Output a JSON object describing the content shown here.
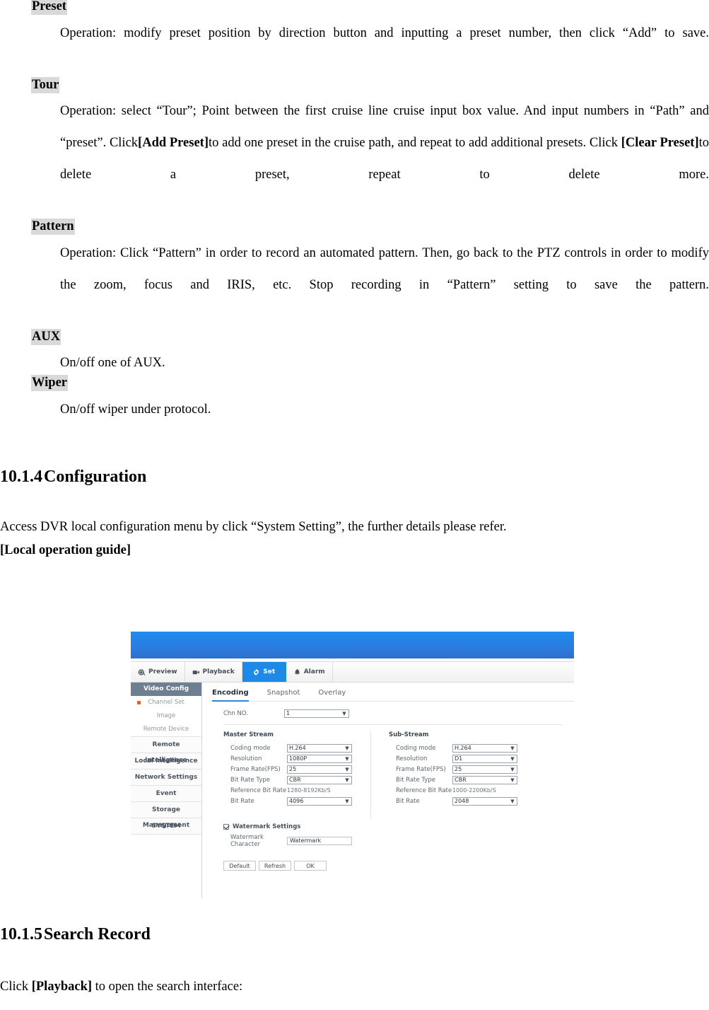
{
  "document": {
    "terms": [
      {
        "heading": "Preset",
        "body": "Operation: modify preset position by direction button and inputting a preset number, then click “Add” to save."
      },
      {
        "heading": "Tour",
        "body_part1": "Operation: select “Tour”; Point between the first cruise line cruise input box value. And input numbers in “Path” and “preset”. Click",
        "bold1": "[Add Preset]",
        "body_part2": "to add one preset in the cruise path, and repeat to add additional presets. Click ",
        "bold2": "[Clear Preset]",
        "body_part3": "to delete a preset, repeat to delete more."
      },
      {
        "heading": "Pattern",
        "body": "Operation: Click “Pattern” in order to record an automated pattern. Then, go back to the PTZ controls in order to modify the zoom, focus and IRIS, etc. Stop recording in “Pattern” setting to save the pattern."
      },
      {
        "heading": "AUX",
        "body": "On/off one of AUX."
      },
      {
        "heading": "Wiper",
        "body": "On/off wiper under protocol."
      }
    ],
    "section_config": {
      "number": "10.1.4",
      "title": "Configuration",
      "para": "Access DVR local configuration menu by click “System Setting”, the further details please refer.",
      "bold_line": "[Local operation guide]"
    },
    "section_search": {
      "number": "10.1.5",
      "title": "Search Record",
      "para_prefix": "Click ",
      "para_bold": "[Playback]",
      "para_suffix": " to open the search interface:"
    }
  },
  "screenshot": {
    "header_color": "#1f8cf0",
    "nav_tabs": [
      {
        "label": "Preview",
        "icon": "preview-icon",
        "active": false
      },
      {
        "label": "Playback",
        "icon": "playback-icon",
        "active": false
      },
      {
        "label": "Set",
        "icon": "gear-icon",
        "active": true
      },
      {
        "label": "Alarm",
        "icon": "bell-icon",
        "active": false
      }
    ],
    "sidebar": {
      "header": "Video Config",
      "sub_items": [
        {
          "label": "Channel Set",
          "selected": true,
          "marker_color": "#ef5a24"
        },
        {
          "label": "Image",
          "selected": false
        },
        {
          "label": "Remote Device",
          "selected": false
        }
      ],
      "items": [
        {
          "label": "Remote Intelligence"
        },
        {
          "label": "Local intelligence"
        },
        {
          "label": "Network Settings"
        },
        {
          "label": "Event"
        },
        {
          "label": "Storage Management"
        },
        {
          "label": "SYSTEM"
        }
      ]
    },
    "content_tabs": [
      {
        "label": "Encoding",
        "active": true
      },
      {
        "label": "Snapshot",
        "active": false
      },
      {
        "label": "Overlay",
        "active": false
      }
    ],
    "channel": {
      "label": "Chn NO.",
      "value": "1"
    },
    "master_stream": {
      "title": "Master Stream",
      "fields": [
        {
          "label": "Coding mode",
          "value": "H.264",
          "type": "select"
        },
        {
          "label": "Resolution",
          "value": "1080P",
          "type": "select"
        },
        {
          "label": "Frame Rate(FPS)",
          "value": "25",
          "type": "select"
        },
        {
          "label": "Bit Rate Type",
          "value": "CBR",
          "type": "select"
        },
        {
          "label": "Reference Bit Rate",
          "value": "1280-8192Kb/S",
          "type": "static"
        },
        {
          "label": "Bit Rate",
          "value": "4096",
          "type": "select"
        }
      ]
    },
    "sub_stream": {
      "title": "Sub-Stream",
      "fields": [
        {
          "label": "Coding mode",
          "value": "H.264",
          "type": "select"
        },
        {
          "label": "Resolution",
          "value": "D1",
          "type": "select"
        },
        {
          "label": "Frame Rate(FPS)",
          "value": "25",
          "type": "select"
        },
        {
          "label": "Bit Rate Type",
          "value": "CBR",
          "type": "select"
        },
        {
          "label": "Reference Bit Rate",
          "value": "1000-2200Kb/S",
          "type": "static"
        },
        {
          "label": "Bit Rate",
          "value": "2048",
          "type": "select"
        }
      ]
    },
    "watermark": {
      "settings_label": "Watermark Settings",
      "checked": true,
      "character_label": "Watermark Character",
      "character_value": "Watermark"
    },
    "buttons": [
      {
        "label": "Default"
      },
      {
        "label": "Refresh"
      },
      {
        "label": "OK"
      }
    ]
  }
}
